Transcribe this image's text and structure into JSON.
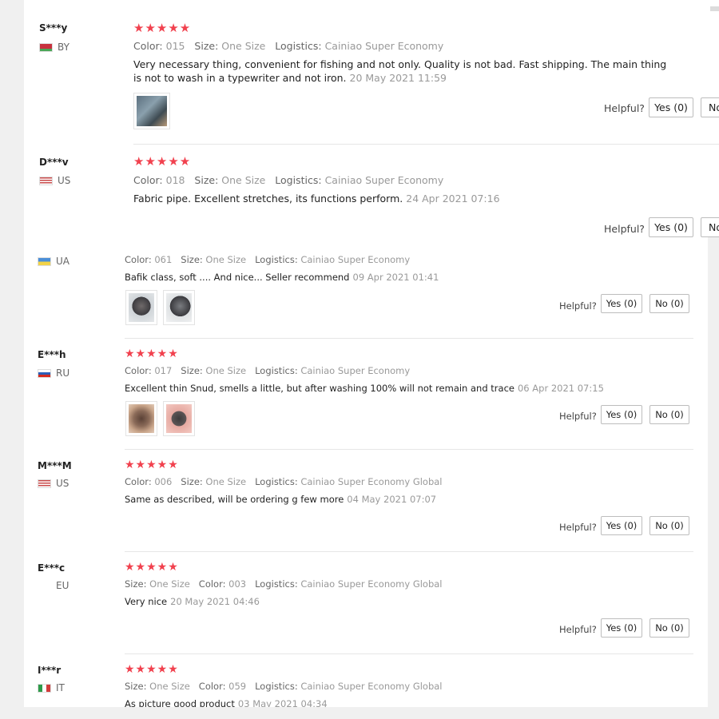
{
  "labels": {
    "color": "Color:",
    "size": "Size:",
    "logistics": "Logistics:",
    "helpful": "Helpful?"
  },
  "reviews": [
    {
      "user": "S***y",
      "country": "BY",
      "stars": "★★★★★",
      "color": "015",
      "size": "One Size",
      "logistics": "Cainiao Super Economy",
      "text": "Very necessary thing, convenient for fishing and not only. Quality is not bad. Fast shipping. The main thing is not to wash in a typewriter and not iron.",
      "date": "20 May 2021 11:59",
      "yes": "Yes (0)",
      "no": "No"
    },
    {
      "user": "D***v",
      "country": "US",
      "stars": "★★★★★",
      "color": "018",
      "size": "One Size",
      "logistics": "Cainiao Super Economy",
      "text": "Fabric pipe. Excellent stretches, its functions perform.",
      "date": "24 Apr 2021 07:16",
      "yes": "Yes (0)",
      "no": "No"
    },
    {
      "user": "",
      "country": "UA",
      "stars": "",
      "color": "061",
      "size": "One Size",
      "logistics": "Cainiao Super Economy",
      "text": "Bafik class, soft .... And nice... Seller recommend",
      "date": "09 Apr 2021 01:41",
      "yes": "Yes (0)",
      "no": "No (0)"
    },
    {
      "user": "E***h",
      "country": "RU",
      "stars": "★★★★★",
      "color": "017",
      "size": "One Size",
      "logistics": "Cainiao Super Economy",
      "text": "Excellent thin Snud, smells a little, but after washing 100% will not remain and trace",
      "date": "06 Apr 2021 07:15",
      "yes": "Yes (0)",
      "no": "No (0)"
    },
    {
      "user": "M***M",
      "country": "US",
      "stars": "★★★★★",
      "color": "006",
      "size": "One Size",
      "logistics": "Cainiao Super Economy Global",
      "text": "Same as described, will be ordering g few more",
      "date": "04 May 2021 07:07",
      "yes": "Yes (0)",
      "no": "No (0)"
    },
    {
      "user": "E***c",
      "country": "EU",
      "stars": "★★★★★",
      "size": "One Size",
      "color": "003",
      "logistics": "Cainiao Super Economy Global",
      "text": "Very nice",
      "date": "20 May 2021 04:46",
      "yes": "Yes (0)",
      "no": "No (0)"
    },
    {
      "user": "I***r",
      "country": "IT",
      "stars": "★★★★★",
      "size": "One Size",
      "color": "059",
      "logistics": "Cainiao Super Economy Global",
      "text": "As picture good product",
      "date": "03 May 2021 04:34"
    }
  ],
  "colors": {
    "star": "#f1414e",
    "muted": "#999999",
    "separator": "#e6e6e6",
    "button_border": "#bdbdbd"
  }
}
